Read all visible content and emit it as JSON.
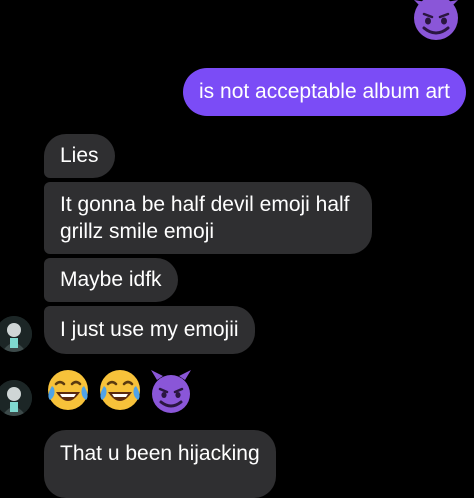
{
  "header": {
    "top_emoji": "smiling-devil-emoji"
  },
  "messages": {
    "outgoing": [
      {
        "text": "is not acceptable album art"
      }
    ],
    "incoming": [
      {
        "text": "Lies"
      },
      {
        "line1": "It gonna be half devil emoji half",
        "line2": "grillz smile emoji"
      },
      {
        "text": "Maybe idfk"
      },
      {
        "text": "I just use my emojii"
      },
      {
        "emojis": [
          "face-with-tears-of-joy-emoji",
          "face-with-tears-of-joy-emoji",
          "smiling-devil-emoji"
        ]
      },
      {
        "text": "That u been hijacking"
      }
    ]
  },
  "colors": {
    "background": "#000000",
    "outgoing_bubble": "#7b4cf6",
    "incoming_bubble": "#2f2f31",
    "text": "#ffffff"
  }
}
